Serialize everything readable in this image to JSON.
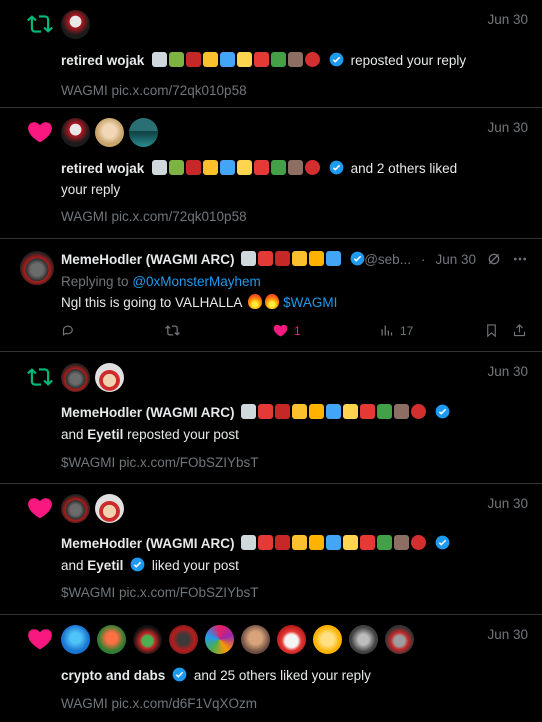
{
  "notifications": [
    {
      "kind": "repost",
      "date": "Jun 30",
      "actor": "retired wojak",
      "action": "reposted your reply",
      "snippet": "WAGMI pic.x.com/72qk010p58"
    },
    {
      "kind": "like",
      "date": "Jun 30",
      "actor": "retired wojak",
      "action": "and 2 others liked",
      "action2": "your reply",
      "snippet": "WAGMI pic.x.com/72qk010p58"
    },
    {
      "kind": "post",
      "author": "MemeHodler (WAGMI ARC)",
      "handle": "@seb...",
      "date": "Jun 30",
      "replying_prefix": "Replying to",
      "replying_to": "@0xMonsterMayhem",
      "text": "Ngl this is going to VALHALLA",
      "cashtag": "$WAGMI",
      "likes": "1",
      "views": "17"
    },
    {
      "kind": "repost",
      "date": "Jun 30",
      "actor": "MemeHodler (WAGMI ARC)",
      "and_text": "and",
      "actor2": "Eyetil",
      "action": "reposted your post",
      "snippet": "$WAGMI pic.x.com/FObSZIYbsT"
    },
    {
      "kind": "like",
      "date": "Jun 30",
      "actor": "MemeHodler (WAGMI ARC)",
      "and_text": "and",
      "actor2": "Eyetil",
      "action": "liked your post",
      "snippet": "$WAGMI pic.x.com/FObSZIYbsT"
    },
    {
      "kind": "like",
      "date": "Jun 30",
      "actor": "crypto and dabs",
      "action": "and 25 others liked your reply",
      "snippet": "WAGMI pic.x.com/d6F1VqXOzm"
    }
  ],
  "colors": {
    "repost_green": "#00ba7c",
    "like_pink": "#f91880",
    "verified_blue": "#1d9bf0",
    "muted": "#71767b"
  },
  "icons": [
    "repost-icon",
    "heart-icon",
    "verified-badge-icon",
    "reply-icon",
    "views-icon",
    "bookmark-icon",
    "share-icon",
    "grok-icon",
    "more-icon"
  ]
}
